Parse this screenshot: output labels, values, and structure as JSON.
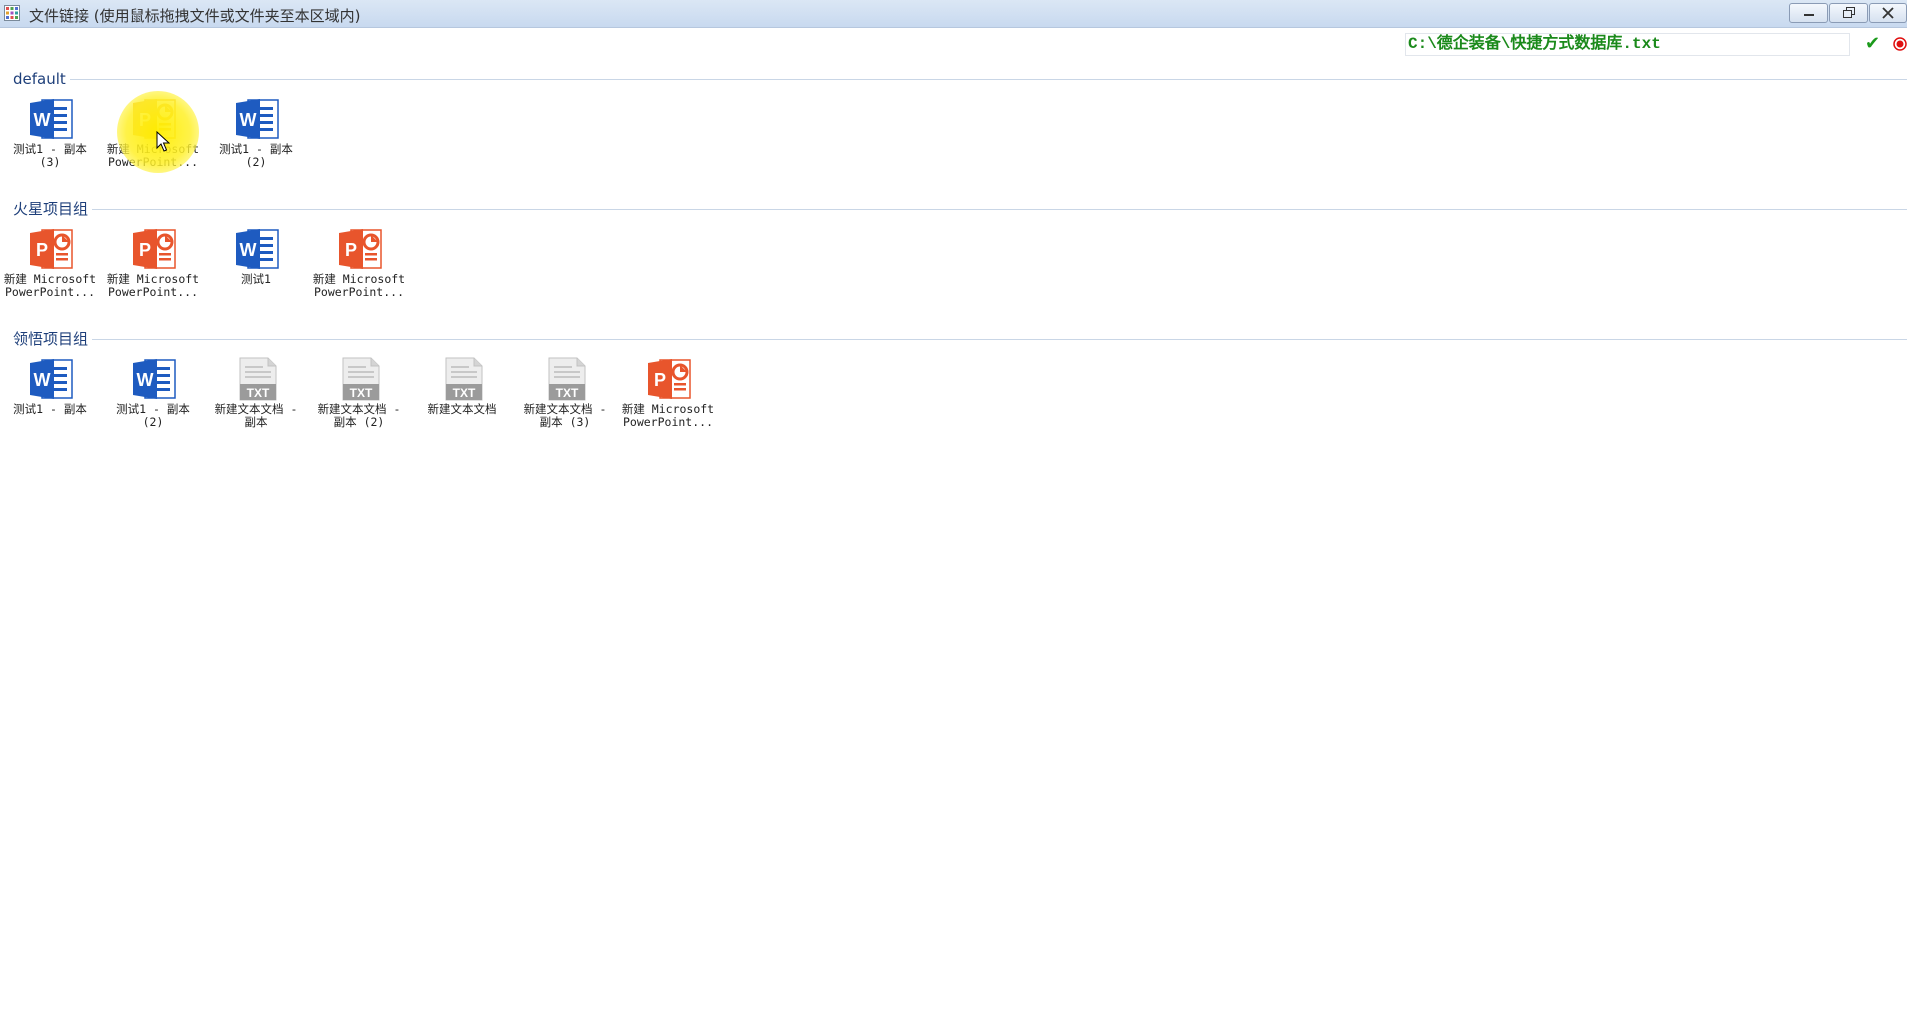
{
  "window": {
    "title": "文件链接 (使用鼠标拖拽文件或文件夹至本区域内)",
    "controls": [
      "minimize-icon",
      "restore-icon",
      "close-icon"
    ]
  },
  "toolbar": {
    "path_value": "C:\\德企装备\\快捷方式数据库.txt",
    "confirm_icon": "checkmark-icon",
    "record_icon": "record-icon"
  },
  "colors": {
    "word": "#1e5bc0",
    "ppt": "#e8552c",
    "ppt_highlighted": "#f2b820",
    "txt": "#9b9b9b",
    "group_title": "#1e3f7a",
    "path_text": "#1b8a1b"
  },
  "groups": [
    {
      "name": "default",
      "items": [
        {
          "type": "word",
          "label": "测试1 - 副本\n(3)"
        },
        {
          "type": "ppt",
          "label": "新建 Microsoft\nPowerPoint...",
          "highlighted": true
        },
        {
          "type": "word",
          "label": "测试1 - 副本\n(2)"
        }
      ]
    },
    {
      "name": "火星项目组",
      "items": [
        {
          "type": "ppt",
          "label": "新建 Microsoft\nPowerPoint..."
        },
        {
          "type": "ppt",
          "label": "新建 Microsoft\nPowerPoint..."
        },
        {
          "type": "word",
          "label": "测试1"
        },
        {
          "type": "ppt",
          "label": "新建 Microsoft\nPowerPoint..."
        }
      ]
    },
    {
      "name": "领悟项目组",
      "items": [
        {
          "type": "word",
          "label": "测试1 - 副本"
        },
        {
          "type": "word",
          "label": "测试1 - 副本\n(2)"
        },
        {
          "type": "txt",
          "label": "新建文本文档 -\n副本"
        },
        {
          "type": "txt",
          "label": "新建文本文档 -\n副本 (2)"
        },
        {
          "type": "txt",
          "label": "新建文本文档"
        },
        {
          "type": "txt",
          "label": "新建文本文档 -\n副本 (3)"
        },
        {
          "type": "ppt",
          "label": "新建 Microsoft\nPowerPoint..."
        }
      ]
    }
  ]
}
